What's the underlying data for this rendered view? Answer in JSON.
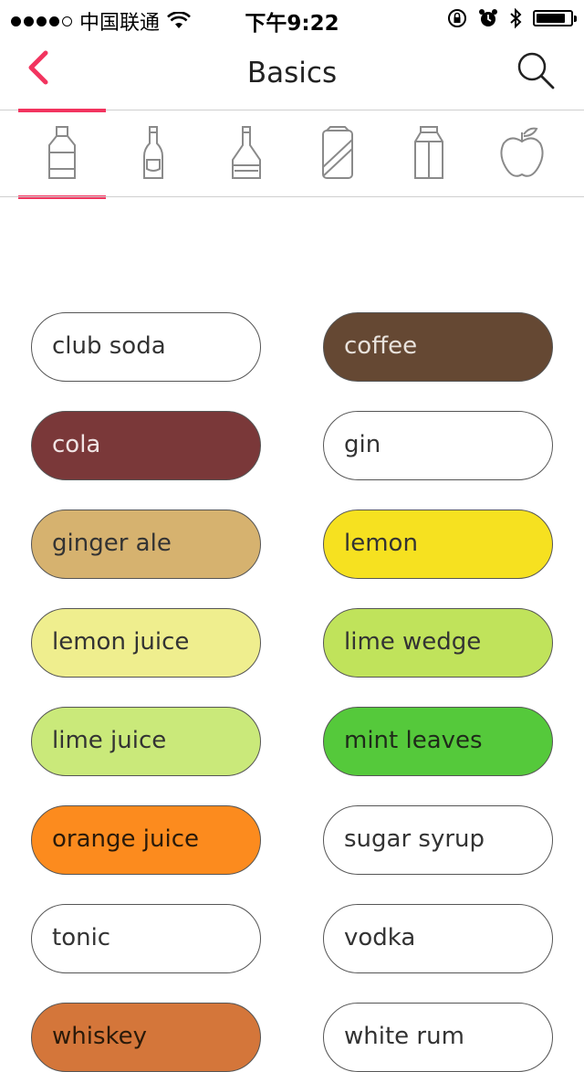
{
  "status_bar": {
    "carrier": "中国联通",
    "time": "下午9:22",
    "signal_bars": 4,
    "battery_level": 0.85
  },
  "nav": {
    "title": "Basics",
    "accent_color": "#f2345f"
  },
  "tabs": [
    {
      "icon": "liquor-bottle-icon",
      "selected": true
    },
    {
      "icon": "beer-bottle-icon",
      "selected": false
    },
    {
      "icon": "wine-bottle-icon",
      "selected": false
    },
    {
      "icon": "soda-can-icon",
      "selected": false
    },
    {
      "icon": "milk-carton-icon",
      "selected": false
    },
    {
      "icon": "apple-icon",
      "selected": false
    }
  ],
  "ingredients": [
    {
      "label": "club soda",
      "bg": "#ffffff",
      "fg": "#333333"
    },
    {
      "label": "coffee",
      "bg": "#654833",
      "fg": "#e8e2dc"
    },
    {
      "label": "cola",
      "bg": "#7a3839",
      "fg": "#f0e4e4"
    },
    {
      "label": "gin",
      "bg": "#ffffff",
      "fg": "#333333"
    },
    {
      "label": "ginger ale",
      "bg": "#d6b26f",
      "fg": "#333333"
    },
    {
      "label": "lemon",
      "bg": "#f6e120",
      "fg": "#333333"
    },
    {
      "label": "lemon juice",
      "bg": "#efee8e",
      "fg": "#333333"
    },
    {
      "label": "lime wedge",
      "bg": "#c0e35b",
      "fg": "#333333"
    },
    {
      "label": "lime juice",
      "bg": "#cae97a",
      "fg": "#333333"
    },
    {
      "label": "mint leaves",
      "bg": "#55c93b",
      "fg": "#1f2a1a"
    },
    {
      "label": "orange juice",
      "bg": "#fc8b1e",
      "fg": "#2a1a0a"
    },
    {
      "label": "sugar syrup",
      "bg": "#ffffff",
      "fg": "#333333"
    },
    {
      "label": "tonic",
      "bg": "#ffffff",
      "fg": "#333333"
    },
    {
      "label": "vodka",
      "bg": "#ffffff",
      "fg": "#333333"
    },
    {
      "label": "whiskey",
      "bg": "#d4763a",
      "fg": "#2a1a0a"
    },
    {
      "label": "white rum",
      "bg": "#ffffff",
      "fg": "#333333"
    }
  ]
}
